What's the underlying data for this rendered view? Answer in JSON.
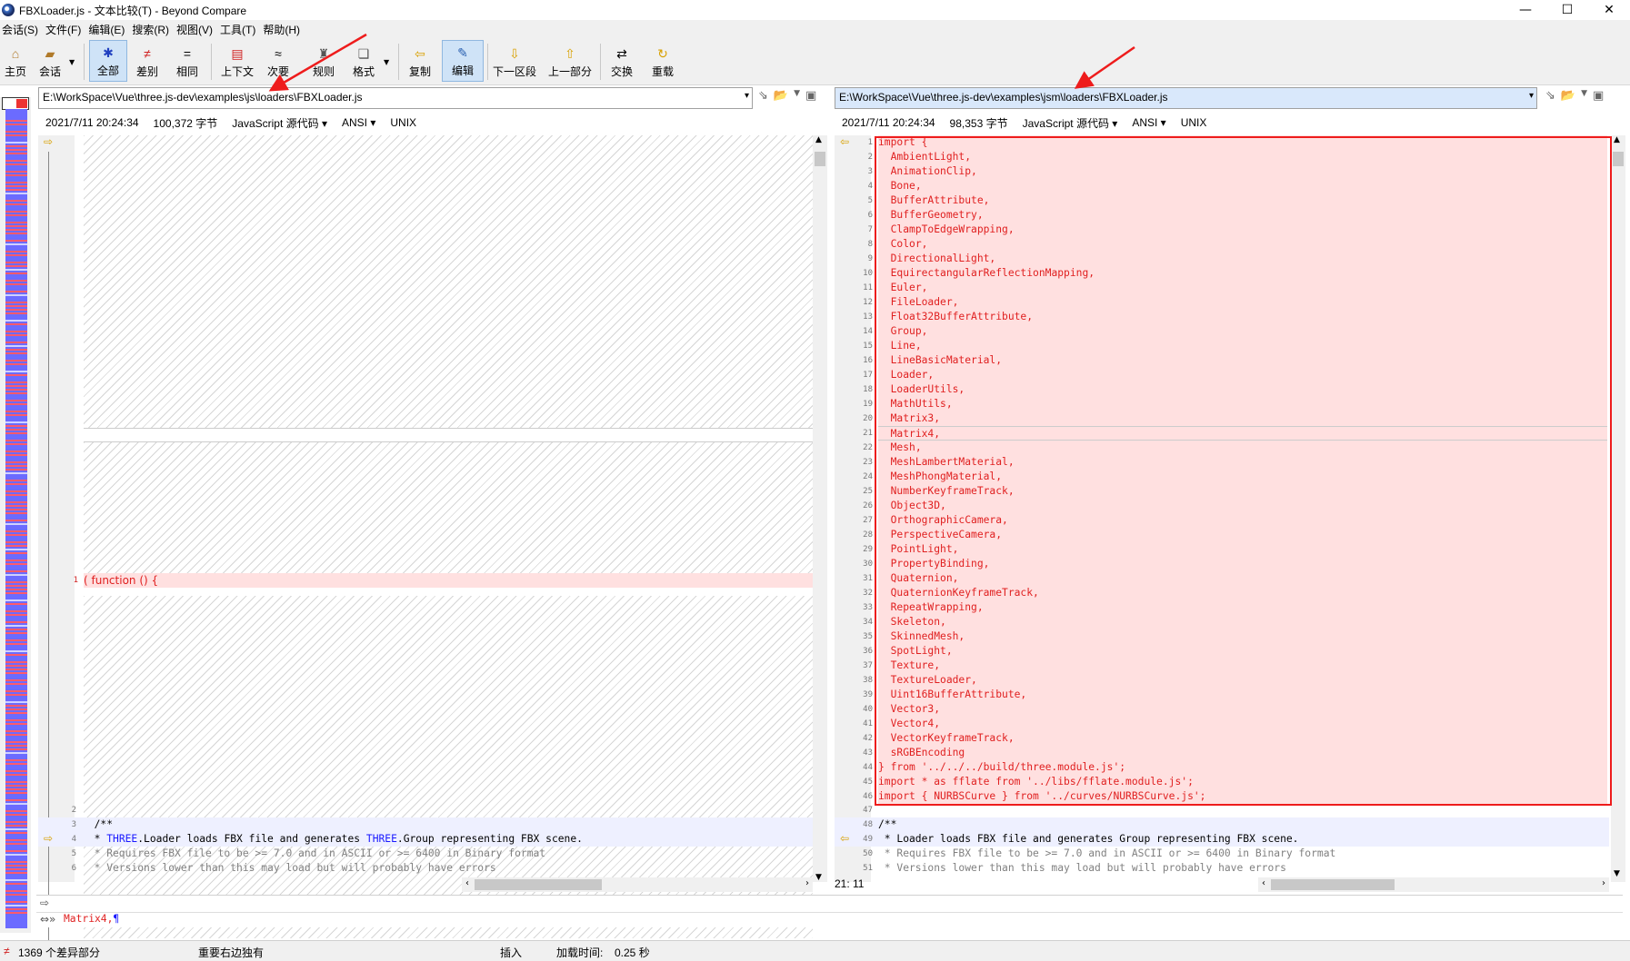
{
  "window": {
    "title": "FBXLoader.js - 文本比较(T) - Beyond Compare",
    "minimize": "—",
    "maximize": "☐",
    "close": "✕"
  },
  "menu": [
    "会话(S)",
    "文件(F)",
    "编辑(E)",
    "搜索(R)",
    "视图(V)",
    "工具(T)",
    "帮助(H)"
  ],
  "toolbar": {
    "home": "主页",
    "session": "会话",
    "all": "全部",
    "diffs": "差别",
    "same": "相同",
    "context": "上下文",
    "minor": "次要",
    "rules": "规则",
    "format": "格式",
    "copy": "复制",
    "edit": "编辑",
    "next_section": "下一区段",
    "prev_section": "上一部分",
    "swap": "交换",
    "reload": "重载"
  },
  "left": {
    "path": "E:\\WorkSpace\\Vue\\three.js-dev\\examples\\js\\loaders\\FBXLoader.js",
    "date": "2021/7/11 20:24:34",
    "size": "100,372 字节",
    "format": "JavaScript 源代码",
    "encoding": "ANSI",
    "eol": "UNIX",
    "line1": "( function () {",
    "tail": [
      {
        "n": "2",
        "t": ""
      },
      {
        "n": "3",
        "t": "  /**"
      },
      {
        "n": "4",
        "pre": "  * ",
        "k1": "THREE",
        "mid": ".Loader loads FBX file and generates ",
        "k2": "THREE",
        "post": ".Group representing FBX scene."
      },
      {
        "n": "5",
        "t": "  * Requires FBX file to be >= 7.0 and in ASCII or >= 6400 in Binary format"
      },
      {
        "n": "6",
        "t": "  * Versions lower than this may load but will probably have errors"
      }
    ]
  },
  "right": {
    "path": "E:\\WorkSpace\\Vue\\three.js-dev\\examples\\jsm\\loaders\\FBXLoader.js",
    "date": "2021/7/11 20:24:34",
    "size": "98,353 字节",
    "format": "JavaScript 源代码",
    "encoding": "ANSI",
    "eol": "UNIX",
    "lines": [
      "import {",
      "\tAmbientLight,",
      "\tAnimationClip,",
      "\tBone,",
      "\tBufferAttribute,",
      "\tBufferGeometry,",
      "\tClampToEdgeWrapping,",
      "\tColor,",
      "\tDirectionalLight,",
      "\tEquirectangularReflectionMapping,",
      "\tEuler,",
      "\tFileLoader,",
      "\tFloat32BufferAttribute,",
      "\tGroup,",
      "\tLine,",
      "\tLineBasicMaterial,",
      "\tLoader,",
      "\tLoaderUtils,",
      "\tMathUtils,",
      "\tMatrix3,",
      "\tMatrix4,",
      "\tMesh,",
      "\tMeshLambertMaterial,",
      "\tMeshPhongMaterial,",
      "\tNumberKeyframeTrack,",
      "\tObject3D,",
      "\tOrthographicCamera,",
      "\tPerspectiveCamera,",
      "\tPointLight,",
      "\tPropertyBinding,",
      "\tQuaternion,",
      "\tQuaternionKeyframeTrack,",
      "\tRepeatWrapping,",
      "\tSkeleton,",
      "\tSkinnedMesh,",
      "\tSpotLight,",
      "\tTexture,",
      "\tTextureLoader,",
      "\tUint16BufferAttribute,",
      "\tVector3,",
      "\tVector4,",
      "\tVectorKeyframeTrack,",
      "\tsRGBEncoding",
      "} from '../../../build/three.module.js';",
      "import * as fflate from '../libs/fflate.module.js';",
      "import { NURBSCurve } from '../curves/NURBSCurve.js';"
    ],
    "tail": [
      {
        "n": "47",
        "t": ""
      },
      {
        "n": "48",
        "t": "/**"
      },
      {
        "n": "49",
        "t": " * Loader loads FBX file and generates Group representing FBX scene."
      },
      {
        "n": "50",
        "t": " * Requires FBX file to be >= 7.0 and in ASCII or >= 6400 in Binary format"
      },
      {
        "n": "51",
        "t": " * Versions lower than this may load but will probably have errors"
      }
    ],
    "cursor": "21: 11"
  },
  "bottom": {
    "line_text": "Matrix4,",
    "pilcrow": "¶"
  },
  "status": {
    "diff_count": "1369 个差异部分",
    "mode": "重要右边独有",
    "insert": "插入",
    "load_time_label": "加载时间:",
    "load_time": "0.25 秒"
  },
  "colors": {
    "diff_red": "#e02020",
    "overview_blue": "#6b6bff",
    "annotation_red": "#ee1c1c"
  }
}
